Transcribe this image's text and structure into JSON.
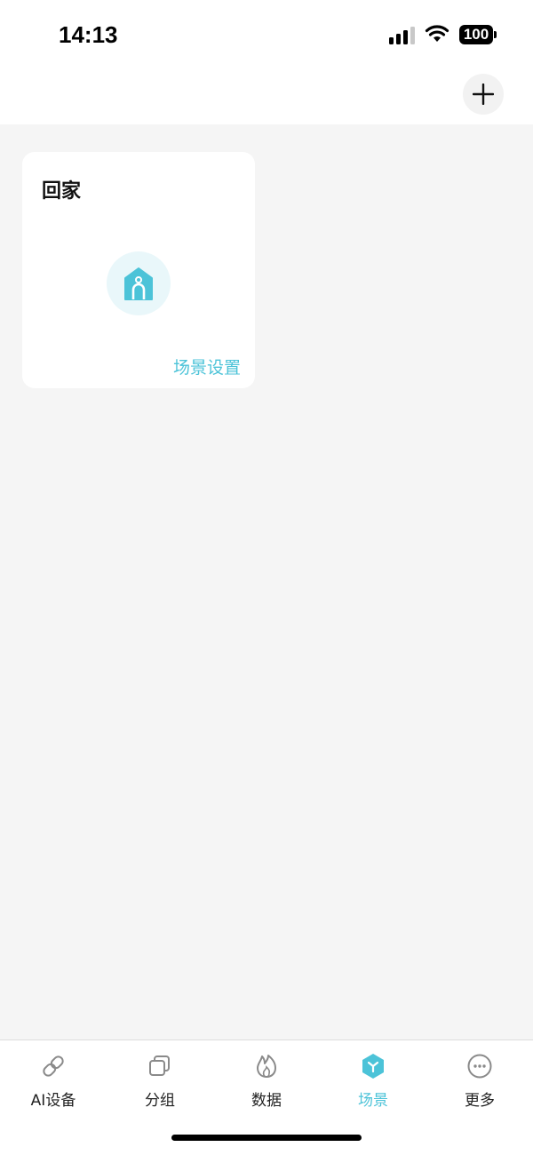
{
  "status_bar": {
    "time": "14:13",
    "battery": "100"
  },
  "header": {
    "add_icon": "plus-icon"
  },
  "scenes": [
    {
      "title": "回家",
      "icon": "home-icon",
      "settings_label": "场景设置"
    }
  ],
  "tabbar": {
    "active": "场景",
    "accent_color": "#4cc3d8",
    "tabs": [
      {
        "label": "AI设备",
        "icon": "link-icon"
      },
      {
        "label": "分组",
        "icon": "copy-icon"
      },
      {
        "label": "数据",
        "icon": "flame-icon"
      },
      {
        "label": "场景",
        "icon": "scene-cube-icon"
      },
      {
        "label": "更多",
        "icon": "more-dots-icon"
      }
    ]
  }
}
